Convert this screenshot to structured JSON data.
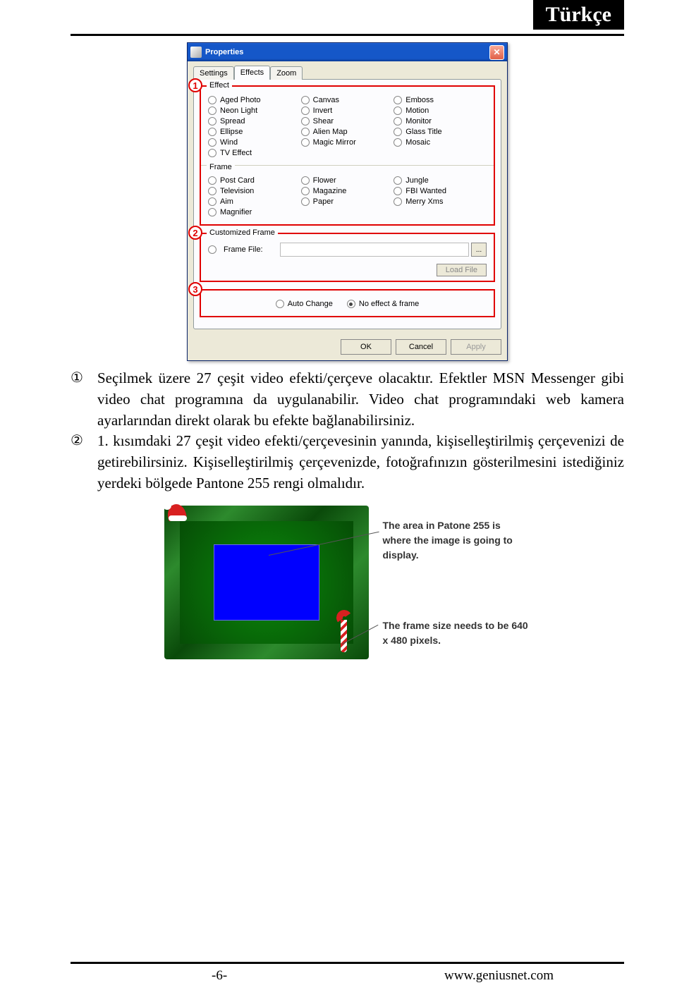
{
  "header": {
    "label": "Türkçe"
  },
  "window": {
    "title": "Properties",
    "tabs": [
      "Settings",
      "Effects",
      "Zoom"
    ],
    "active_tab": 1,
    "effect": {
      "legend": "Effect",
      "options": [
        "Aged Photo",
        "Canvas",
        "Emboss",
        "Neon Light",
        "Invert",
        "Motion",
        "Spread",
        "Shear",
        "Monitor",
        "Ellipse",
        "Alien Map",
        "Glass Title",
        "Wind",
        "Magic Mirror",
        "Mosaic",
        "TV Effect",
        "",
        ""
      ]
    },
    "frame": {
      "legend": "Frame",
      "options": [
        "Post Card",
        "Flower",
        "Jungle",
        "Television",
        "Magazine",
        "FBI Wanted",
        "Aim",
        "Paper",
        "Merry Xms",
        "Magnifier",
        "",
        ""
      ]
    },
    "customized": {
      "legend": "Customized Frame",
      "frame_file_label": "Frame File:",
      "browse_label": "...",
      "load_label": "Load File"
    },
    "bottom": {
      "auto_change": "Auto Change",
      "no_effect": "No effect & frame",
      "selected": "no_effect"
    },
    "buttons": {
      "ok": "OK",
      "cancel": "Cancel",
      "apply": "Apply"
    }
  },
  "markers": {
    "m1": "1",
    "m2": "2",
    "m3": "3"
  },
  "body": {
    "n1": "①",
    "p1": "Seçilmek üzere 27 çeşit video efekti/çerçeve olacaktır. Efektler MSN Messenger gibi video chat programına da uygulanabilir. Video chat programındaki web kamera ayarlarından direkt olarak bu efekte bağlanabilirsiniz.",
    "n2": "②",
    "p2": "1. kısımdaki 27 çeşit video efekti/çerçevesinin yanında, kişiselleştirilmiş çerçevenizi de getirebilirsiniz. Kişiselleştirilmiş çerçevenizde, fotoğrafınızın gösterilmesini istediğiniz yerdeki bölgede Pantone 255 rengi olmalıdır."
  },
  "figure": {
    "callout1": "The area in Patone 255 is where the image is going to display.",
    "callout2": "The frame size needs to be 640 x 480 pixels."
  },
  "footer": {
    "page": "-6-",
    "url": "www.geniusnet.com"
  }
}
